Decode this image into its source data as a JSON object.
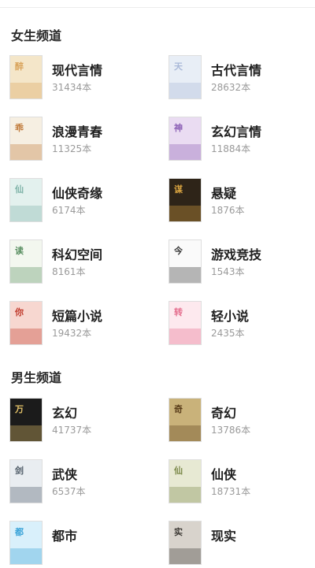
{
  "sections": [
    {
      "title": "女生频道",
      "items": [
        {
          "name": "现代言情",
          "count": "31434本",
          "cover": {
            "bg": "#f4e6c9",
            "accent": "#d9a35b",
            "deco": "醉"
          }
        },
        {
          "name": "古代言情",
          "count": "28632本",
          "cover": {
            "bg": "#e8eef6",
            "accent": "#a9b8d8",
            "deco": "天"
          }
        },
        {
          "name": "浪漫青春",
          "count": "11325本",
          "cover": {
            "bg": "#f6efe2",
            "accent": "#c07a3a",
            "deco": "乖"
          }
        },
        {
          "name": "玄幻言情",
          "count": "11884本",
          "cover": {
            "bg": "#eadcf2",
            "accent": "#8b5fb5",
            "deco": "神"
          }
        },
        {
          "name": "仙侠奇缘",
          "count": "6174本",
          "cover": {
            "bg": "#e3f1ee",
            "accent": "#7fb3a8",
            "deco": "仙"
          }
        },
        {
          "name": "悬疑",
          "count": "1876本",
          "cover": {
            "bg": "#2e2418",
            "accent": "#d9a441",
            "deco": "谋"
          }
        },
        {
          "name": "科幻空间",
          "count": "8161本",
          "cover": {
            "bg": "#f3f7ef",
            "accent": "#5a8f62",
            "deco": "读"
          }
        },
        {
          "name": "游戏竞技",
          "count": "1543本",
          "cover": {
            "bg": "#fafafa",
            "accent": "#333333",
            "deco": "今"
          }
        },
        {
          "name": "短篇小说",
          "count": "19432本",
          "cover": {
            "bg": "#f7d7d0",
            "accent": "#c0392b",
            "deco": "你"
          }
        },
        {
          "name": "轻小说",
          "count": "2435本",
          "cover": {
            "bg": "#fde9ee",
            "accent": "#e46c8c",
            "deco": "转"
          }
        }
      ]
    },
    {
      "title": "男生频道",
      "items": [
        {
          "name": "玄幻",
          "count": "41737本",
          "cover": {
            "bg": "#1b1b1b",
            "accent": "#e6c46a",
            "deco": "万"
          }
        },
        {
          "name": "奇幻",
          "count": "13786本",
          "cover": {
            "bg": "#c9b27a",
            "accent": "#5b3f1c",
            "deco": "奇"
          }
        },
        {
          "name": "武侠",
          "count": "6537本",
          "cover": {
            "bg": "#e9edf1",
            "accent": "#4d5a66",
            "deco": "剑"
          }
        },
        {
          "name": "仙侠",
          "count": "18731本",
          "cover": {
            "bg": "#e7e9d3",
            "accent": "#7c8a4b",
            "deco": "仙"
          }
        },
        {
          "name": "都市",
          "count": "",
          "cover": {
            "bg": "#d9f0fb",
            "accent": "#3aa3d8",
            "deco": "都"
          }
        },
        {
          "name": "现实",
          "count": "",
          "cover": {
            "bg": "#d8d3cc",
            "accent": "#3d3a35",
            "deco": "实"
          }
        }
      ]
    }
  ]
}
